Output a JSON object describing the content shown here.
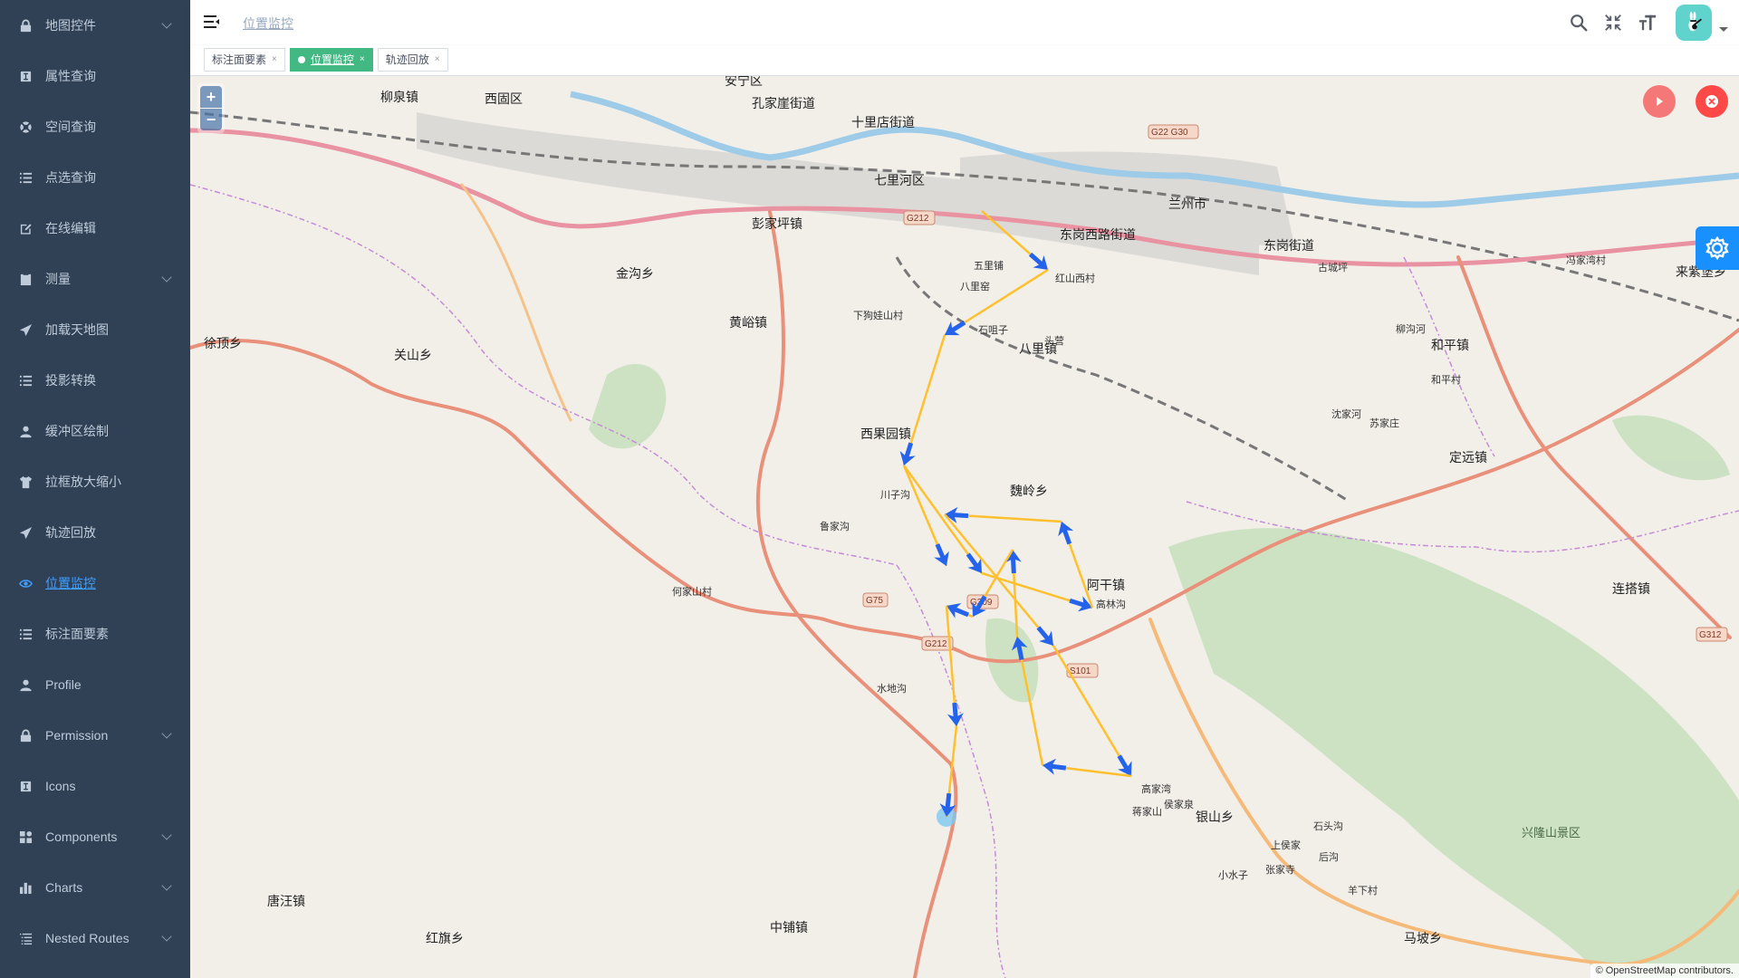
{
  "sidebar": {
    "items": [
      {
        "label": "地图控件",
        "icon": "lock-icon",
        "expandable": true
      },
      {
        "label": "属性查询",
        "icon": "text-cursor-icon",
        "expandable": false
      },
      {
        "label": "空间查询",
        "icon": "lifebuoy-icon",
        "expandable": false
      },
      {
        "label": "点选查询",
        "icon": "list-icon",
        "expandable": false
      },
      {
        "label": "在线编辑",
        "icon": "edit-icon",
        "expandable": false
      },
      {
        "label": "测量",
        "icon": "clipboard-icon",
        "expandable": true
      },
      {
        "label": "加载天地图",
        "icon": "paper-plane-icon",
        "expandable": false
      },
      {
        "label": "投影转换",
        "icon": "list-icon",
        "expandable": false
      },
      {
        "label": "缓冲区绘制",
        "icon": "user-icon",
        "expandable": false
      },
      {
        "label": "拉框放大缩小",
        "icon": "shirt-icon",
        "expandable": false
      },
      {
        "label": "轨迹回放",
        "icon": "paper-plane-icon",
        "expandable": false
      },
      {
        "label": "位置监控",
        "icon": "eye-icon",
        "expandable": false,
        "active": true
      },
      {
        "label": "标注面要素",
        "icon": "list-icon",
        "expandable": false
      },
      {
        "label": "Profile",
        "icon": "user-icon",
        "expandable": false
      },
      {
        "label": "Permission",
        "icon": "lock-icon",
        "expandable": true
      },
      {
        "label": "Icons",
        "icon": "text-cursor-icon",
        "expandable": false
      },
      {
        "label": "Components",
        "icon": "components-icon",
        "expandable": true
      },
      {
        "label": "Charts",
        "icon": "bar-chart-icon",
        "expandable": true
      },
      {
        "label": "Nested Routes",
        "icon": "nested-list-icon",
        "expandable": true
      }
    ]
  },
  "navbar": {
    "breadcrumb": "位置监控",
    "icons": [
      "search-icon",
      "exit-fullscreen-icon",
      "font-size-icon"
    ],
    "avatar": "user-avatar"
  },
  "tags": [
    {
      "label": "标注面要素",
      "close": "×",
      "active": false
    },
    {
      "label": "位置监控",
      "close": "×",
      "active": true
    },
    {
      "label": "轨迹回放",
      "close": "×",
      "active": false
    }
  ],
  "map": {
    "zoom_in": "+",
    "zoom_out": "−",
    "attribution": "© OpenStreetMap contributors.",
    "route_color": "#ffc02e",
    "arrow_color": "#2563eb",
    "labels": [
      {
        "text": "兰州市",
        "big": true
      },
      {
        "text": "七里河区",
        "big": true
      },
      {
        "text": "安宁区",
        "big": true
      },
      {
        "text": "西固区",
        "big": true
      },
      {
        "text": "东岗西路街道",
        "big": true
      },
      {
        "text": "东岗街道",
        "big": true
      },
      {
        "text": "十里店街道",
        "big": true
      },
      {
        "text": "孔家崖街道",
        "big": true
      },
      {
        "text": "彭家坪镇",
        "big": true
      },
      {
        "text": "柳泉镇",
        "big": true
      },
      {
        "text": "八里镇",
        "big": true
      },
      {
        "text": "西果园镇",
        "big": true
      },
      {
        "text": "魏岭乡",
        "big": true
      },
      {
        "text": "阿干镇",
        "big": true
      },
      {
        "text": "和平镇",
        "big": true
      },
      {
        "text": "定远镇",
        "big": true
      },
      {
        "text": "连搭镇",
        "big": true
      },
      {
        "text": "来紫堡乡",
        "big": true
      },
      {
        "text": "银山乡",
        "big": true
      },
      {
        "text": "马坡乡",
        "big": true
      },
      {
        "text": "中铺镇",
        "big": true
      },
      {
        "text": "唐汪镇",
        "big": true
      },
      {
        "text": "红旗乡",
        "big": true
      },
      {
        "text": "金沟乡",
        "big": true
      },
      {
        "text": "黄峪镇",
        "big": true
      },
      {
        "text": "关山乡",
        "big": true
      },
      {
        "text": "徐顶乡",
        "big": true
      },
      {
        "text": "兴隆山景区",
        "park": true
      },
      {
        "text": "五里铺"
      },
      {
        "text": "八里窑"
      },
      {
        "text": "红山西村"
      },
      {
        "text": "石咀子"
      },
      {
        "text": "头营"
      },
      {
        "text": "下狗娃山村"
      },
      {
        "text": "高林沟"
      },
      {
        "text": "高家湾"
      },
      {
        "text": "蒋家山"
      },
      {
        "text": "水地沟"
      },
      {
        "text": "川子沟"
      },
      {
        "text": "鲁家沟"
      },
      {
        "text": "何家山村"
      },
      {
        "text": "侯家泉"
      },
      {
        "text": "石头沟"
      },
      {
        "text": "上侯家"
      },
      {
        "text": "张家寺"
      },
      {
        "text": "后沟"
      },
      {
        "text": "羊下村"
      },
      {
        "text": "小水子"
      },
      {
        "text": "柳沟河"
      },
      {
        "text": "和平村"
      },
      {
        "text": "苏家庄"
      },
      {
        "text": "沈家河"
      },
      {
        "text": "冯家湾村"
      },
      {
        "text": "古城坪"
      }
    ],
    "shields": [
      "G212",
      "G309",
      "G75",
      "S101",
      "G22 G30",
      "G312",
      "G212"
    ]
  }
}
